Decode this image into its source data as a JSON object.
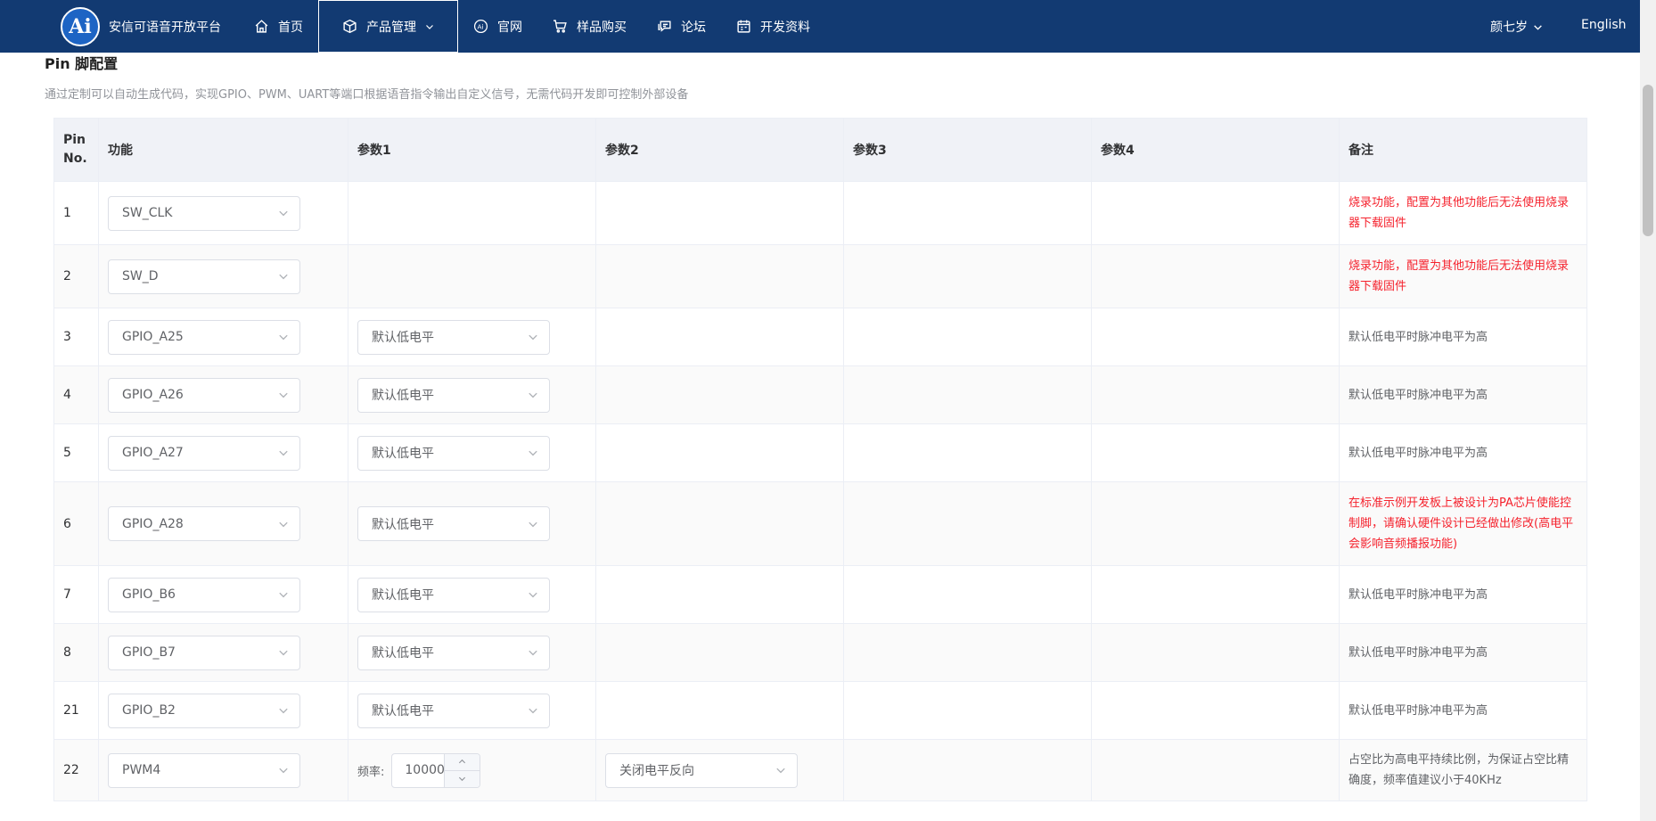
{
  "header": {
    "brand": "安信可语音开放平台",
    "logo_text": "Ai",
    "nav": [
      {
        "label": "首页",
        "icon": "home-icon"
      },
      {
        "label": "产品管理",
        "icon": "box-icon",
        "active": true
      },
      {
        "label": "官网",
        "icon": "ai-icon"
      },
      {
        "label": "样品购买",
        "icon": "cart-icon"
      },
      {
        "label": "论坛",
        "icon": "chat-icon"
      },
      {
        "label": "开发资料",
        "icon": "calendar-icon"
      }
    ],
    "user": "颜七岁",
    "language": "English"
  },
  "section": {
    "title": "Pin 脚配置",
    "description": "通过定制可以自动生成代码，实现GPIO、PWM、UART等端口根据语音指令输出自定义信号，无需代码开发即可控制外部设备"
  },
  "table": {
    "columns": [
      "Pin No.",
      "功能",
      "参数1",
      "参数2",
      "参数3",
      "参数4",
      "备注"
    ],
    "rows": [
      {
        "pin": "1",
        "function": "SW_CLK",
        "param1": "",
        "note": "烧录功能，配置为其他功能后无法使用烧录器下载固件",
        "note_red": true
      },
      {
        "pin": "2",
        "function": "SW_D",
        "param1": "",
        "note": "烧录功能，配置为其他功能后无法使用烧录器下载固件",
        "note_red": true
      },
      {
        "pin": "3",
        "function": "GPIO_A25",
        "param1": "默认低电平",
        "note": "默认低电平时脉冲电平为高",
        "note_red": false
      },
      {
        "pin": "4",
        "function": "GPIO_A26",
        "param1": "默认低电平",
        "note": "默认低电平时脉冲电平为高",
        "note_red": false
      },
      {
        "pin": "5",
        "function": "GPIO_A27",
        "param1": "默认低电平",
        "note": "默认低电平时脉冲电平为高",
        "note_red": false
      },
      {
        "pin": "6",
        "function": "GPIO_A28",
        "param1": "默认低电平",
        "note": "在标准示例开发板上被设计为PA芯片使能控制脚，请确认硬件设计已经做出修改(高电平会影响音频播报功能)",
        "note_red": true
      },
      {
        "pin": "7",
        "function": "GPIO_B6",
        "param1": "默认低电平",
        "note": "默认低电平时脉冲电平为高",
        "note_red": false
      },
      {
        "pin": "8",
        "function": "GPIO_B7",
        "param1": "默认低电平",
        "note": "默认低电平时脉冲电平为高",
        "note_red": false
      },
      {
        "pin": "21",
        "function": "GPIO_B2",
        "param1": "默认低电平",
        "note": "默认低电平时脉冲电平为高",
        "note_red": false
      },
      {
        "pin": "22",
        "function": "PWM4",
        "freq_label": "频率:",
        "freq_value": "10000",
        "param2": "关闭电平反向",
        "note": "占空比为高电平持续比例，为保证占空比精确度，频率值建议小于40KHz",
        "note_red": false
      }
    ]
  },
  "colors": {
    "topbar": "#123a72",
    "note_red": "#f5222d",
    "header_bg": "#f0f2f7"
  }
}
